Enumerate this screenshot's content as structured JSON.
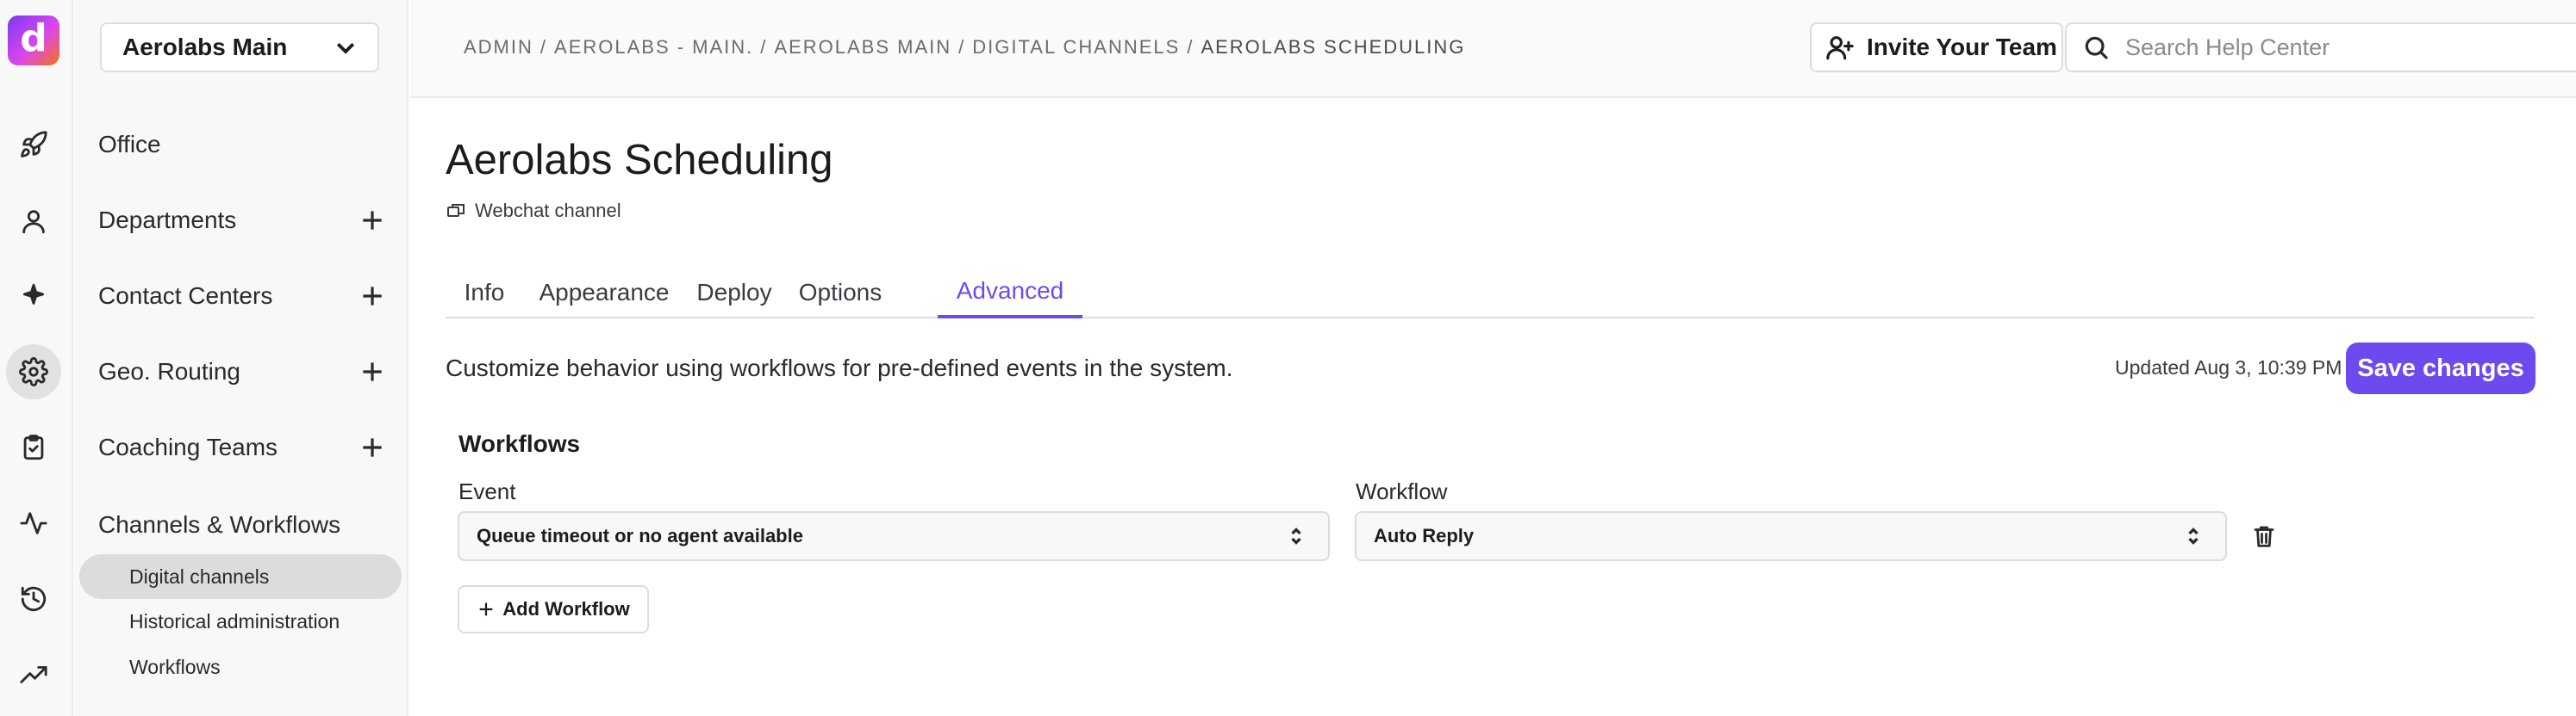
{
  "brand": {
    "logo_letter": "d",
    "accent": "#6d4aef"
  },
  "rail": {
    "icons": [
      "rocket-icon",
      "user-icon",
      "sparkle-icon",
      "gear-icon",
      "clipboard-icon",
      "activity-icon",
      "history-icon",
      "trending-up-icon"
    ],
    "active": "gear-icon"
  },
  "sidebar": {
    "org_select": "Aerolabs Main",
    "items": [
      {
        "label": "Office",
        "has_add": false
      },
      {
        "label": "Departments",
        "has_add": true
      },
      {
        "label": "Contact Centers",
        "has_add": true
      },
      {
        "label": "Geo. Routing",
        "has_add": true
      },
      {
        "label": "Coaching Teams",
        "has_add": true
      },
      {
        "label": "Channels & Workflows",
        "has_add": false
      }
    ],
    "sub_items": [
      {
        "label": "Digital channels",
        "active": true
      },
      {
        "label": "Historical administration",
        "active": false
      },
      {
        "label": "Workflows",
        "active": false
      }
    ]
  },
  "header": {
    "breadcrumb": [
      "ADMIN",
      "AEROLABS - MAIN.",
      "AEROLABS MAIN",
      "DIGITAL CHANNELS",
      "AEROLABS SCHEDULING"
    ],
    "invite_label": "Invite Your Team",
    "search_placeholder": "Search Help Center"
  },
  "page": {
    "title": "Aerolabs Scheduling",
    "channel_type": "Webchat channel",
    "tabs": [
      "Info",
      "Appearance",
      "Deploy",
      "Options",
      "Advanced"
    ],
    "active_tab": "Advanced",
    "description": "Customize behavior using workflows for pre-defined events in the system.",
    "updated": "Updated Aug 3, 10:39 PM",
    "save_label": "Save changes"
  },
  "workflows": {
    "title": "Workflows",
    "event_label": "Event",
    "workflow_label": "Workflow",
    "rows": [
      {
        "event": "Queue timeout or no agent available",
        "workflow": "Auto Reply"
      }
    ],
    "add_label": "Add Workflow"
  }
}
